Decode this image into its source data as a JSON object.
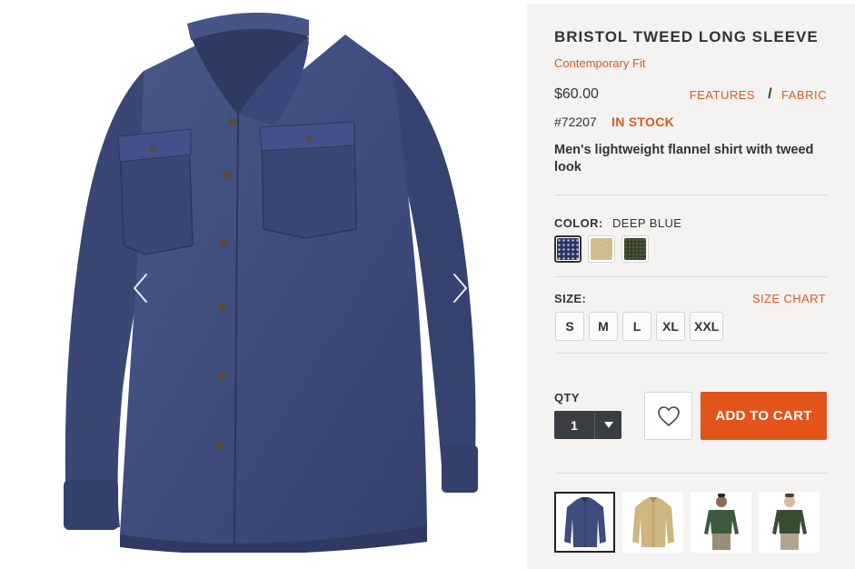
{
  "gallery": {
    "main_image": "blue-flannel-shirt",
    "prev_icon": "chevron-left-icon",
    "next_icon": "chevron-right-icon"
  },
  "product": {
    "title": "BRISTOL TWEED LONG SLEEVE",
    "fit": "Contemporary Fit",
    "price": "$60.00",
    "links": {
      "features": "FEATURES",
      "separator": "/",
      "fabric": "FABRIC"
    },
    "sku": "#72207",
    "stock": "IN STOCK",
    "description": "Men's lightweight flannel shirt with tweed look"
  },
  "color": {
    "label": "COLOR:",
    "selected": "DEEP BLUE",
    "swatches": [
      {
        "name": "deep-blue",
        "hex": "#2d3464",
        "selected": true
      },
      {
        "name": "khaki",
        "hex": "#cdb67f",
        "selected": false
      },
      {
        "name": "dark-green",
        "hex": "#36432c",
        "selected": false
      }
    ]
  },
  "size": {
    "label": "SIZE:",
    "chart_link": "SIZE CHART",
    "options": [
      "S",
      "M",
      "L",
      "XL",
      "XXL"
    ]
  },
  "purchase": {
    "qty_label": "QTY",
    "qty_value": "1",
    "qty_icon": "caret-down-icon",
    "wishlist_icon": "heart-icon",
    "add_to_cart": "ADD TO CART"
  },
  "thumbnails": [
    {
      "name": "blue-shirt-flat",
      "selected": true
    },
    {
      "name": "khaki-shirt-flat",
      "selected": false
    },
    {
      "name": "green-shirt-model-front",
      "selected": false
    },
    {
      "name": "green-shirt-model-alt",
      "selected": false
    }
  ],
  "colors": {
    "accent": "#d95c1f",
    "cart_button": "#e2541a",
    "panel_bg": "#f4f3f1",
    "shirt_blue": "#3f4c7e"
  }
}
